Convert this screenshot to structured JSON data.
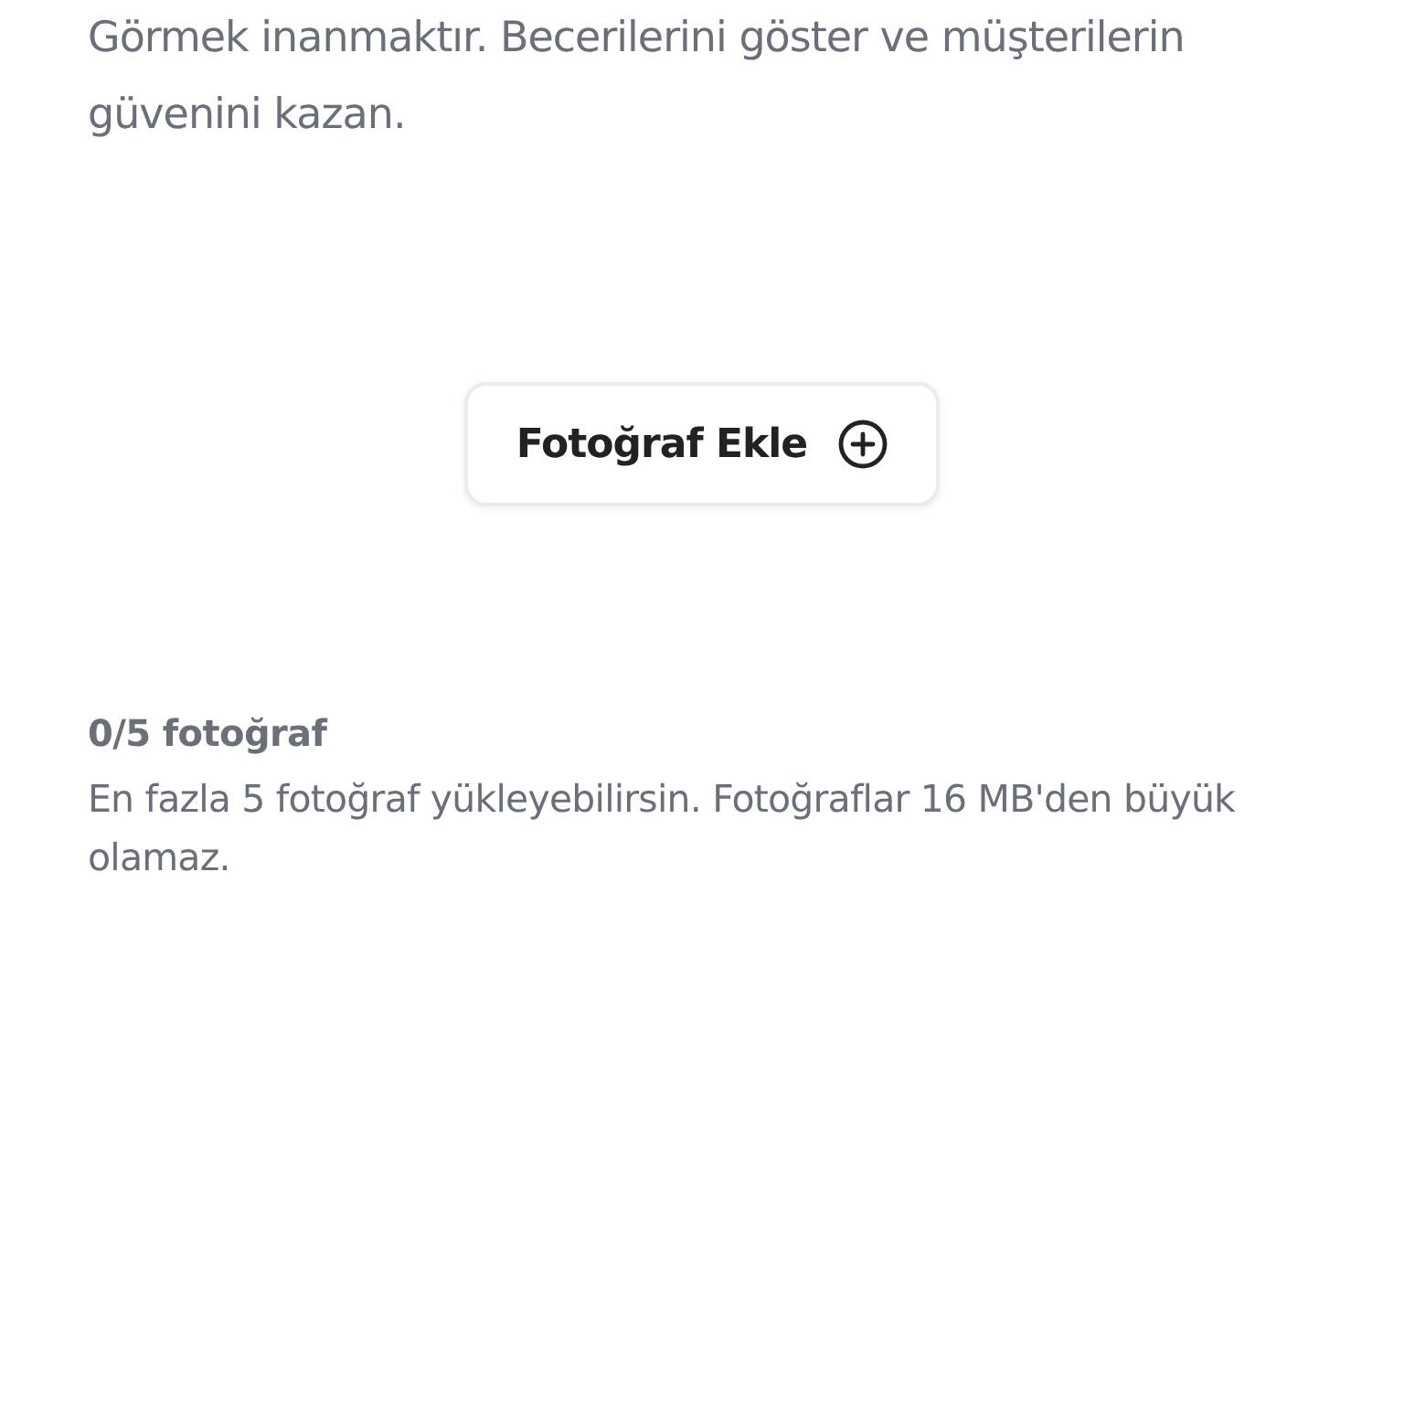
{
  "intro": "Görmek inanmaktır. Becerilerini göster ve müşterilerin güvenini kazan.",
  "add_button": {
    "label": "Fotoğraf Ekle"
  },
  "counter": "0/5 fotoğraf",
  "hint": "En fazla 5 fotoğraf yükleyebilirsin. Fotoğraflar 16 MB'den büyük olamaz."
}
